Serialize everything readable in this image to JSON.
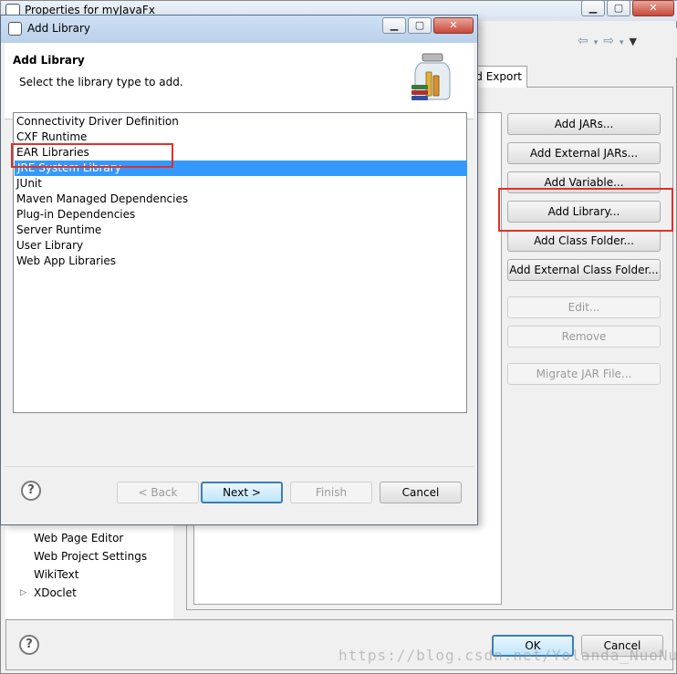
{
  "props_window": {
    "title": "Properties for myJavaFx",
    "tab_partial": "d Export",
    "side_buttons": [
      {
        "label": "Add JARs...",
        "enabled": true
      },
      {
        "label": "Add External JARs...",
        "enabled": true
      },
      {
        "label": "Add Variable...",
        "enabled": true
      },
      {
        "label": "Add Library...",
        "enabled": true
      },
      {
        "label": "Add Class Folder...",
        "enabled": true
      },
      {
        "label": "Add External Class Folder...",
        "enabled": true
      },
      {
        "label": "Edit...",
        "enabled": false
      },
      {
        "label": "Remove",
        "enabled": false
      },
      {
        "label": "Migrate JAR File...",
        "enabled": false
      }
    ],
    "tree_items": [
      "Web Page Editor",
      "Web Project Settings",
      "WikiText",
      "XDoclet"
    ],
    "ok_label": "OK",
    "cancel_label": "Cancel",
    "watermark": "https://blog.csdn.net/Yolanda_NuoNuo"
  },
  "dialog": {
    "title": "Add Library",
    "header_title": "Add Library",
    "header_desc": "Select the library type to add.",
    "libraries": [
      "Connectivity Driver Definition",
      "CXF Runtime",
      "EAR Libraries",
      "JRE System Library",
      "JUnit",
      "Maven Managed Dependencies",
      "Plug-in Dependencies",
      "Server Runtime",
      "User Library",
      "Web App Libraries"
    ],
    "selected_library": "JRE System Library",
    "back_label": "< Back",
    "next_label": "Next >",
    "finish_label": "Finish",
    "cancel_label": "Cancel"
  },
  "colors": {
    "selection": "#3399ff",
    "highlight_box": "#e0302a",
    "default_button_border": "#3c7fb1"
  },
  "icons": [
    "window-icon",
    "minimize-icon",
    "maximize-icon",
    "close-icon",
    "help-icon",
    "library-jar-icon",
    "back-arrow-icon",
    "forward-arrow-icon",
    "dropdown-arrow-icon",
    "tree-expand-icon"
  ]
}
